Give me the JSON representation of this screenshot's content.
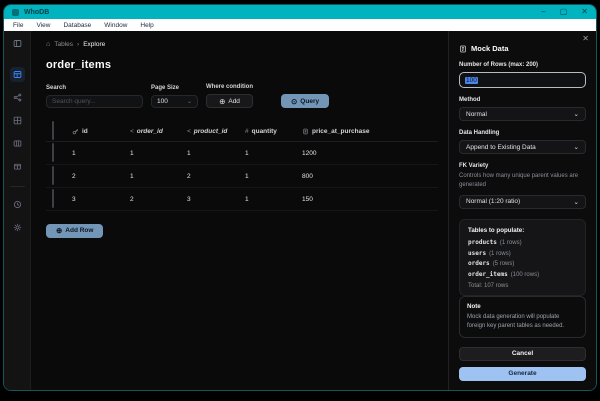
{
  "colors": {
    "titlebar_teal": "#00b3bf",
    "accent_blue": "#3b82f6",
    "steel_button": "#7396b6",
    "generate_blue": "#9ec3f2"
  },
  "window": {
    "title": "WhoDB",
    "controls": [
      {
        "name": "minimize-icon",
        "glyph": "–"
      },
      {
        "name": "maximize-icon",
        "glyph": "▢"
      },
      {
        "name": "close-icon",
        "glyph": "✕"
      }
    ]
  },
  "menubar": {
    "items": [
      "File",
      "View",
      "Database",
      "Window",
      "Help"
    ]
  },
  "sidebar": {
    "items": [
      {
        "name": "sidebar-toggle-icon",
        "icon": "panel",
        "first": true
      },
      {
        "name": "tables-nav-icon",
        "icon": "table",
        "active": true
      },
      {
        "name": "graph-nav-icon",
        "icon": "share"
      },
      {
        "name": "grid-nav-icon",
        "icon": "grid"
      },
      {
        "name": "cells-nav-icon",
        "icon": "cells"
      },
      {
        "name": "storage-nav-icon",
        "icon": "box"
      },
      {
        "divider": true
      },
      {
        "name": "history-icon",
        "icon": "history"
      },
      {
        "name": "settings-gear-icon",
        "icon": "gear"
      }
    ]
  },
  "breadcrumb": {
    "home_glyph": "⌂",
    "root": "Tables",
    "separator": "›",
    "current": "Explore"
  },
  "page": {
    "title": "order_items"
  },
  "toolbar": {
    "search_label": "Search",
    "search_placeholder": "Search query...",
    "page_size_label": "Page Size",
    "page_size_value": "100",
    "where_label": "Where condition",
    "add_label": "Add",
    "add_glyph": "⊕",
    "query_label": "Query",
    "query_glyph": "⊙"
  },
  "table": {
    "columns": [
      {
        "icon": "key",
        "label": "id",
        "italic": false
      },
      {
        "icon": "fk",
        "label": "order_id",
        "italic": true
      },
      {
        "icon": "fk",
        "label": "product_id",
        "italic": true
      },
      {
        "icon": "hash",
        "label": "quantity",
        "italic": false
      },
      {
        "icon": "doc",
        "label": "price_at_purchase",
        "italic": false
      }
    ],
    "rows": [
      [
        "1",
        "1",
        "1",
        "1",
        "1200"
      ],
      [
        "2",
        "1",
        "2",
        "1",
        "800"
      ],
      [
        "3",
        "2",
        "3",
        "1",
        "150"
      ]
    ],
    "add_row_label": "Add Row",
    "add_row_glyph": "⊕"
  },
  "mock_panel": {
    "close_glyph": "✕",
    "title": "Mock Data",
    "rows_label": "Number of Rows (max: 200)",
    "rows_value": "100",
    "method_label": "Method",
    "method_value": "Normal",
    "chevron": "⌄",
    "data_handling_label": "Data Handling",
    "data_handling_value": "Append to Existing Data",
    "fk_variety_label": "FK Variety",
    "fk_variety_help": "Controls how many unique parent values are generated",
    "fk_variety_value": "Normal (1:20 ratio)",
    "tables_box": {
      "title": "Tables to populate:",
      "tables": [
        {
          "name": "products",
          "count": "(1 rows)"
        },
        {
          "name": "users",
          "count": "(1 rows)"
        },
        {
          "name": "orders",
          "count": "(5 rows)"
        },
        {
          "name": "order_items",
          "count": "(100 rows)"
        }
      ],
      "total": "Total: 107 rows"
    },
    "note": {
      "title": "Note",
      "body": "Mock data generation will populate foreign key parent tables as needed."
    },
    "cancel_label": "Cancel",
    "generate_label": "Generate"
  }
}
